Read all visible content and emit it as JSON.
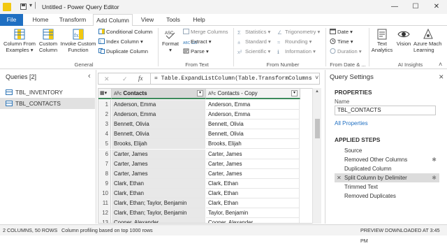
{
  "titlebar": {
    "title": "Untitled - Power Query Editor",
    "chevron": "▾ │",
    "minimize": "—",
    "maximize": "☐",
    "close": "✕"
  },
  "tabs": [
    "File",
    "Home",
    "Transform",
    "Add Column",
    "View",
    "Tools",
    "Help"
  ],
  "ribbon": {
    "general": {
      "label": "General",
      "column_from_examples": [
        "Column From",
        "Examples ▾"
      ],
      "custom_column": [
        "Custom",
        "Column"
      ],
      "invoke_custom_function": [
        "Invoke Custom",
        "Function"
      ],
      "conditional_column": "Conditional Column",
      "index_column": "Index Column ▾",
      "duplicate_column": "Duplicate Column"
    },
    "from_text": {
      "label": "From Text",
      "format": [
        "Format",
        "▾"
      ],
      "format_icon_text": "ASC",
      "merge_columns": "Merge Columns",
      "extract": "Extract ▾",
      "parse": "Parse ▾",
      "extract_icon_text": "ABC 123"
    },
    "from_number": {
      "label": "From Number",
      "statistics": "Statistics ▾",
      "standard": "Standard ▾",
      "scientific": "Scientific ▾",
      "trigonometry": "Trigonometry ▾",
      "rounding": "Rounding ▾",
      "information": "Information ▾"
    },
    "from_date_time": {
      "label": "From Date & ...",
      "date": "Date ▾",
      "time": "Time ▾",
      "duration": "Duration ▾"
    },
    "ai_insights": {
      "label": "AI Insights",
      "text_analytics": [
        "Text",
        "Analytics"
      ],
      "vision": "Vision",
      "azure_ml": [
        "Azure Mach",
        "Learning"
      ]
    },
    "collapse": "˄"
  },
  "queries": {
    "header": "Queries [2]",
    "collapse": "‹",
    "items": [
      "TBL_INVENTORY",
      "TBL_CONTACTS"
    ],
    "selected_index": 1
  },
  "formula_bar": {
    "cancel": "✕",
    "commit": "✓",
    "fx": "fx",
    "formula": "= Table.ExpandListColumn(Table.TransformColumns",
    "expand": "˅"
  },
  "grid": {
    "columns": [
      {
        "type_icon": "Aᴮᴄ",
        "name": "Contacts",
        "filter": "▾"
      },
      {
        "type_icon": "Aᴮᴄ",
        "name": "Contacts - Copy",
        "filter": "▾"
      }
    ],
    "corner_icon": "▦▾",
    "rows": [
      [
        "1",
        "Anderson, Emma",
        "Anderson, Emma"
      ],
      [
        "2",
        "Anderson, Emma",
        "Anderson, Emma"
      ],
      [
        "3",
        "Bennett, Olivia",
        "Bennett, Olivia"
      ],
      [
        "4",
        "Bennett, Olivia",
        "Bennett, Olivia"
      ],
      [
        "5",
        "Brooks, Elijah",
        "Brooks, Elijah"
      ],
      [
        "6",
        "Carter, James",
        "Carter, James"
      ],
      [
        "7",
        "Carter, James",
        "Carter, James"
      ],
      [
        "8",
        "Carter, James",
        "Carter, James"
      ],
      [
        "9",
        "Clark, Ethan",
        "Clark, Ethan"
      ],
      [
        "10",
        "Clark, Ethan",
        "Clark, Ethan"
      ],
      [
        "11",
        "Clark, Ethan; Taylor, Benjamin",
        "Clark, Ethan"
      ],
      [
        "12",
        "Clark, Ethan; Taylor, Benjamin",
        " Taylor, Benjamin"
      ],
      [
        "13",
        "Cooper, Alexander",
        "Cooper, Alexander"
      ]
    ]
  },
  "query_settings": {
    "title": "Query Settings",
    "close": "✕",
    "properties_header": "PROPERTIES",
    "name_label": "Name",
    "name_value": "TBL_CONTACTS",
    "all_properties": "All Properties",
    "applied_steps_header": "APPLIED STEPS",
    "steps": [
      "Source",
      "Removed Other Columns",
      "Duplicated Column",
      "Split Column by Delimiter",
      "Trimmed Text",
      "Removed Duplicates"
    ],
    "selected_step": 3,
    "step_gear": "✱",
    "step_delete": "✕"
  },
  "statusbar": {
    "columns_rows": "2 COLUMNS, 50 ROWS",
    "profiling": "Column profiling based on top 1000 rows",
    "preview": "PREVIEW DOWNLOADED AT 3:45 PM"
  },
  "colors": {
    "accent": "#1f6fc2",
    "header_green": "#3c8a5b",
    "selected_query": "#e1e1e1",
    "selected_step": "#dcdcdc"
  }
}
